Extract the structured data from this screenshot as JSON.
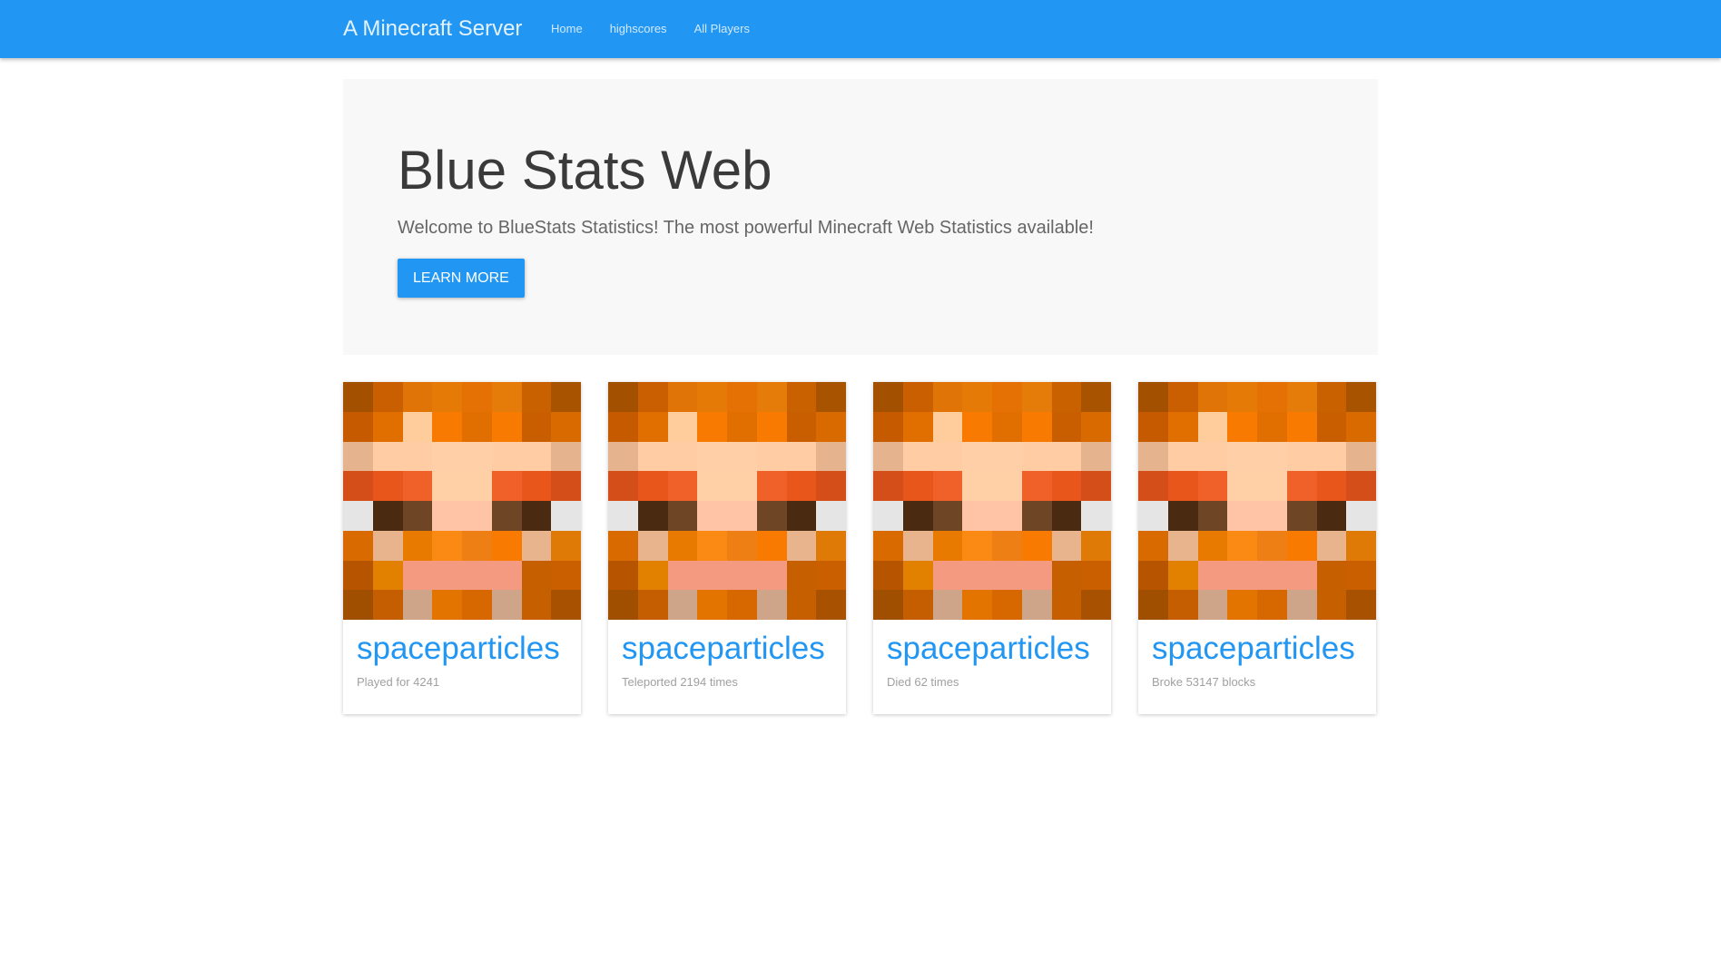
{
  "navbar": {
    "brand": "A Minecraft Server",
    "links": [
      {
        "label": "Home"
      },
      {
        "label": "highscores"
      },
      {
        "label": "All Players"
      }
    ],
    "color": "#2196f3"
  },
  "jumbotron": {
    "title": "Blue Stats Web",
    "subtitle": "Welcome to BlueStats Statistics! The most powerful Minecraft Web Statistics available!",
    "button_label": "LEARN MORE"
  },
  "cards": [
    {
      "player": "spaceparticles",
      "stat": "Played for 4241"
    },
    {
      "player": "spaceparticles",
      "stat": "Teleported 2194 times"
    },
    {
      "player": "spaceparticles",
      "stat": "Died 62 times"
    },
    {
      "player": "spaceparticles",
      "stat": "Broke 53147 blocks"
    }
  ],
  "skin_palette": [
    [
      "#a35000",
      "#c95f00",
      "#e07406",
      "#e57b06",
      "#e57105",
      "#e57c0a",
      "#c96100",
      "#a85300"
    ],
    [
      "#c65a00",
      "#e06f00",
      "#ffcc9c",
      "#f97a00",
      "#e06f00",
      "#f97a00",
      "#c85e00",
      "#d86a00"
    ],
    [
      "#e5b38e",
      "#ffcca4",
      "#ffcca4",
      "#ffd0a8",
      "#ffd0a8",
      "#ffcca4",
      "#ffcca4",
      "#e5b38e"
    ],
    [
      "#d44e1a",
      "#e8561c",
      "#f0612a",
      "#ffcfa6",
      "#ffcfa6",
      "#f0612a",
      "#e8561c",
      "#d44e1a"
    ],
    [
      "#e5e5e5",
      "#4a2a10",
      "#6e4525",
      "#ffc4a6",
      "#ffc4a6",
      "#6e4525",
      "#4a2a10",
      "#e5e5e5"
    ],
    [
      "#d86a00",
      "#e8b48e",
      "#e87a00",
      "#fa8a13",
      "#ee7f14",
      "#f97a00",
      "#e8b48e",
      "#e07a06"
    ],
    [
      "#b65400",
      "#e28100",
      "#f49a80",
      "#f49a80",
      "#f49a80",
      "#f49a80",
      "#c55f00",
      "#ca5f00"
    ],
    [
      "#a04e00",
      "#c45e00",
      "#cfa58a",
      "#e47400",
      "#d76800",
      "#cfa58a",
      "#c55f00",
      "#a85100"
    ]
  ]
}
